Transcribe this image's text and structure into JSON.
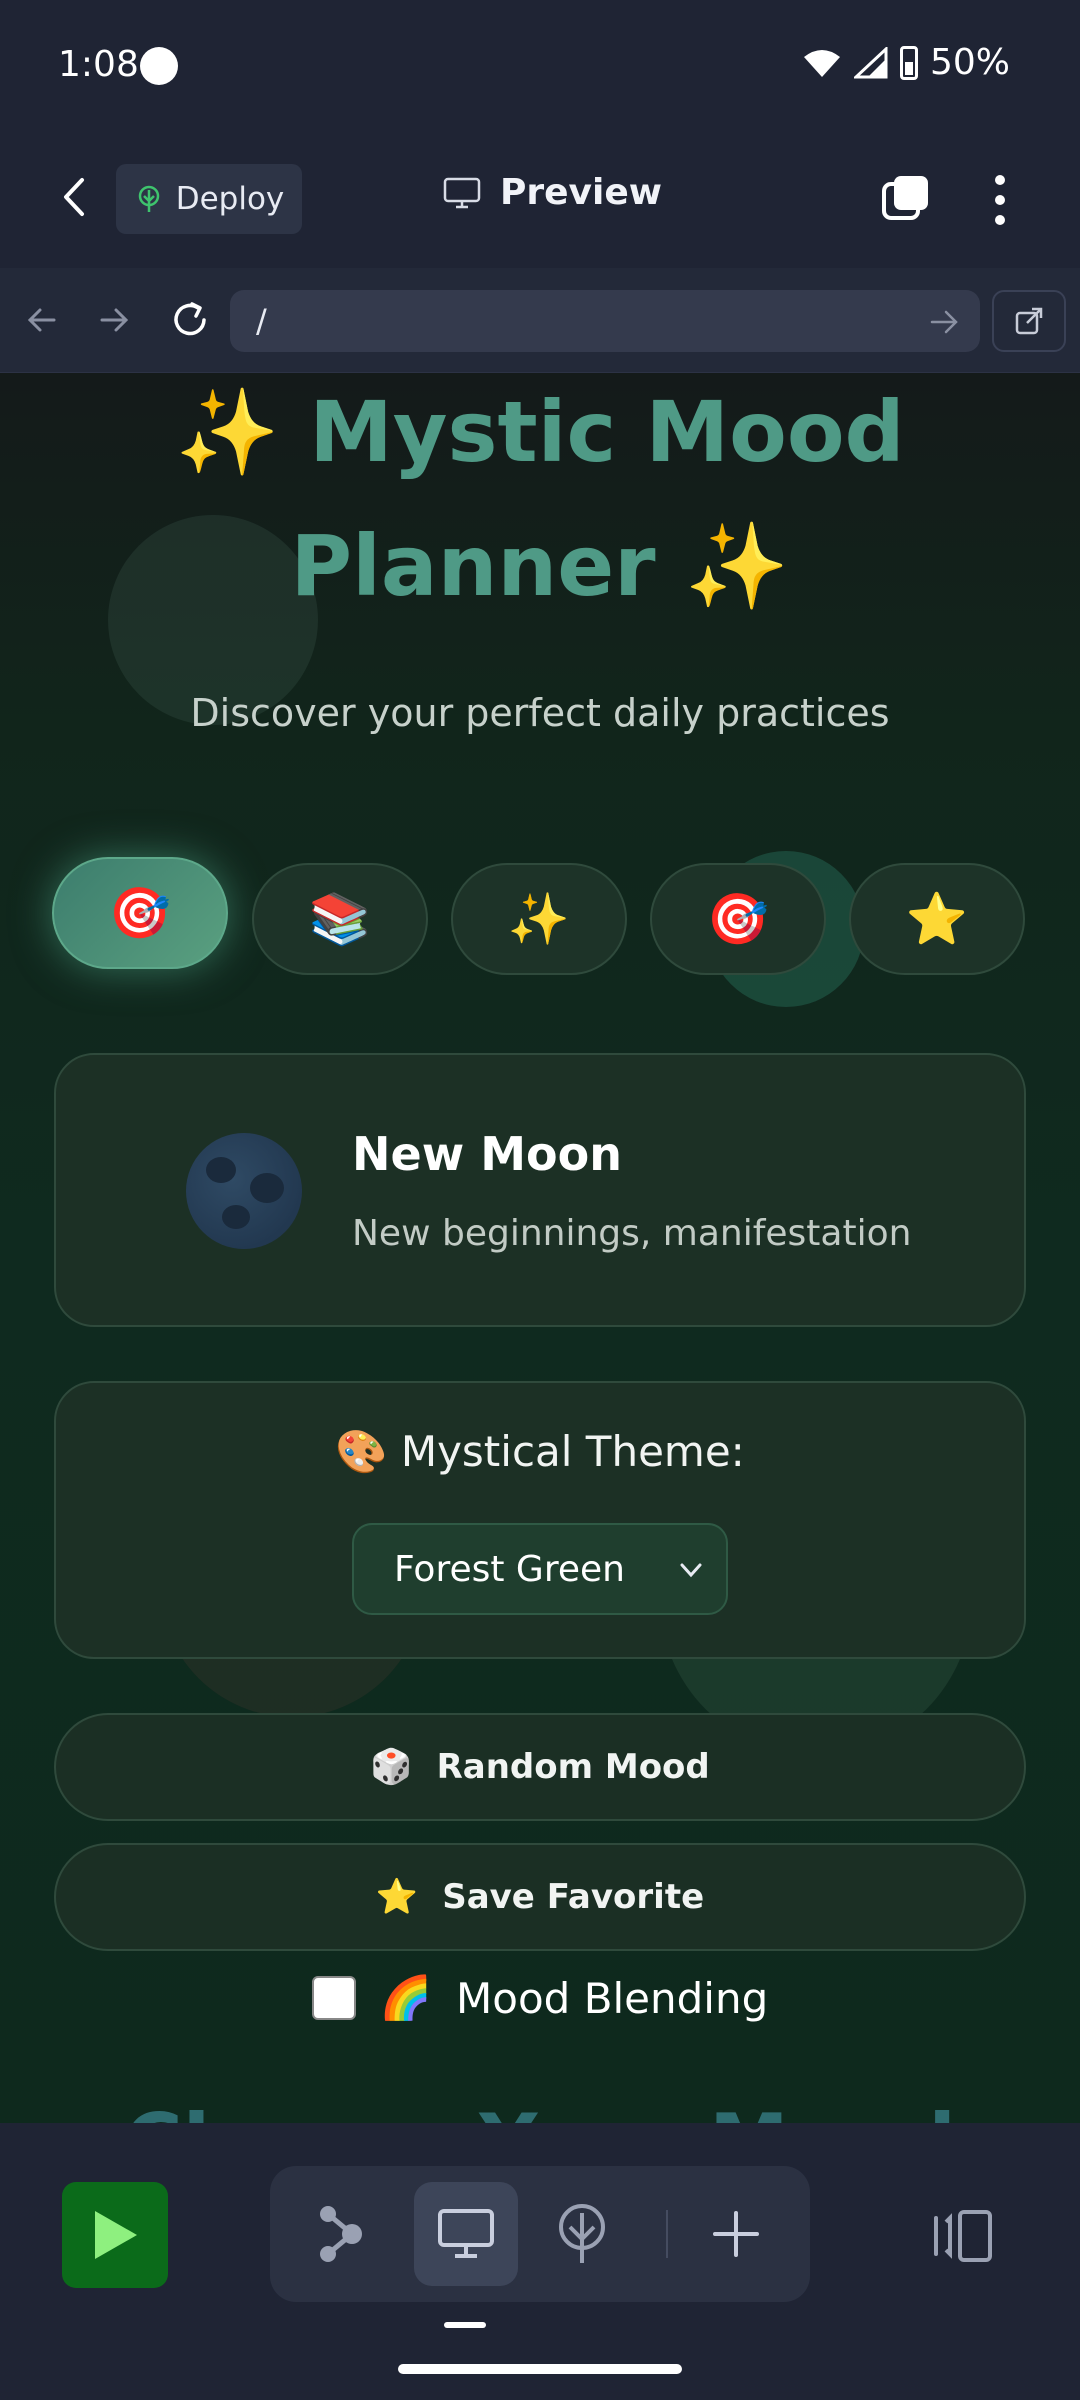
{
  "status_bar": {
    "time": "1:08",
    "battery": "50%"
  },
  "app_bar": {
    "deploy_label": "Deploy",
    "preview_label": "Preview"
  },
  "url_bar": {
    "url": "/"
  },
  "page": {
    "title_line1": "Mystic Mood",
    "title_line2": "Planner",
    "title_sparkle": "✨",
    "subtitle": "Discover your perfect daily practices",
    "mood_chips": [
      "🎯",
      "📚",
      "✨",
      "🎯",
      "⭐"
    ],
    "moon": {
      "name": "New Moon",
      "description": "New beginnings, manifestation"
    },
    "theme": {
      "label": "🎨 Mystical Theme:",
      "selected": "Forest Green"
    },
    "random_button": {
      "icon": "🎲",
      "label": "Random Mood"
    },
    "save_button": {
      "icon": "⭐",
      "label": "Save Favorite"
    },
    "blending": {
      "icon": "🌈",
      "label": "Mood Blending"
    },
    "peek_heading": "Choose Your Mood"
  },
  "colors": {
    "accent_green": "#0b6b1a",
    "title_teal": "#4f9a86",
    "sparkle_blue": "#5a86c8"
  }
}
